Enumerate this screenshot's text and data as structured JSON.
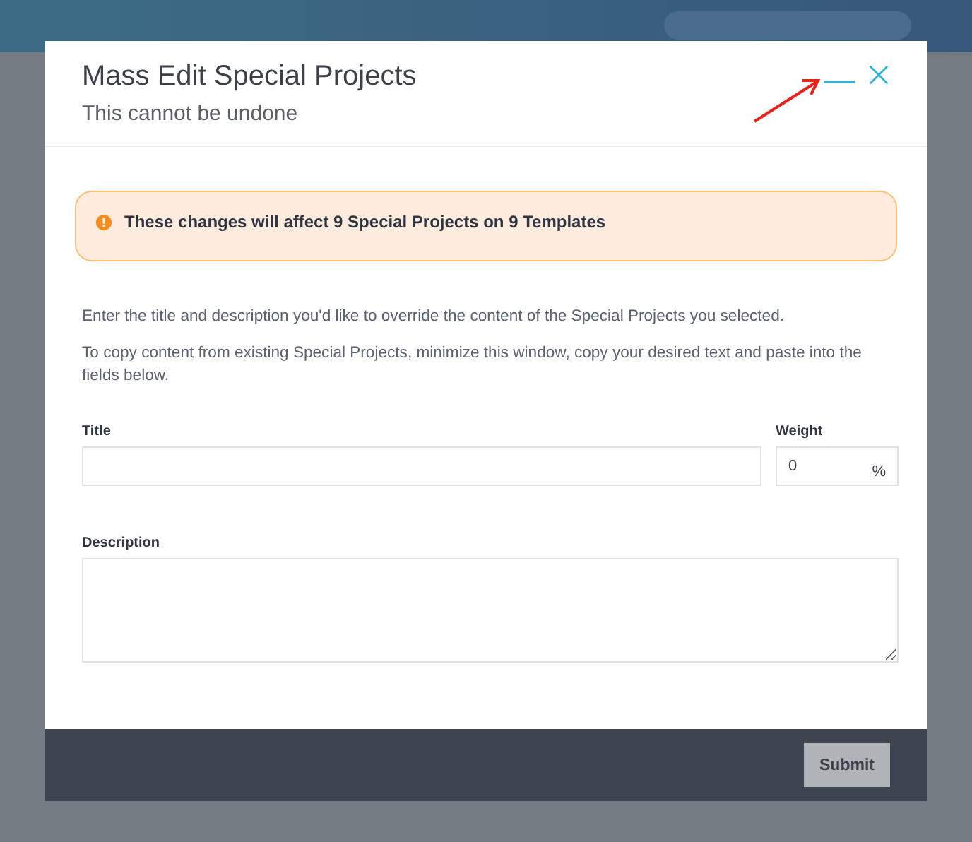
{
  "modal": {
    "title": "Mass Edit Special Projects",
    "subtitle": "This cannot be undone",
    "alert": {
      "text": "These changes will affect 9 Special Projects on 9 Templates"
    },
    "paragraphs": [
      "Enter the title and description you'd like to override the content of the Special Projects you selected.",
      "To copy content from existing Special Projects, minimize this window, copy your desired text and paste into the fields below."
    ],
    "fields": {
      "title": {
        "label": "Title"
      },
      "weight": {
        "label": "Weight",
        "value": "0",
        "suffix": "%"
      },
      "description": {
        "label": "Description"
      }
    },
    "buttons": [
      "Submit"
    ]
  }
}
